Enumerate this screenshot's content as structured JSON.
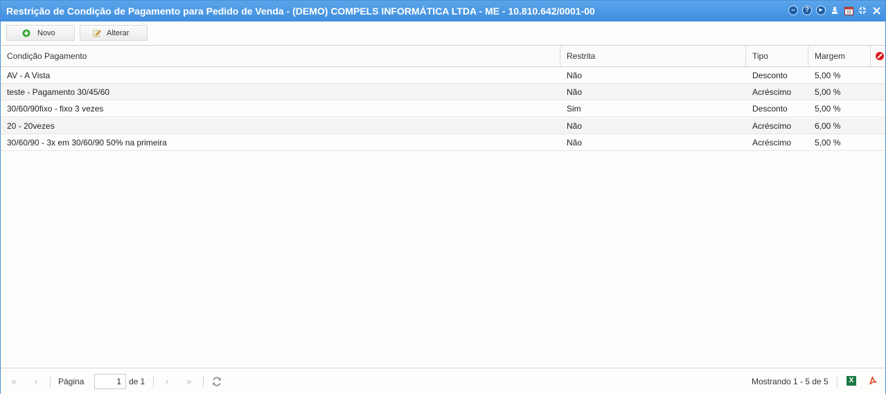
{
  "window": {
    "title": "Restrição de Condição de Pagamento para Pedido de Venda - (DEMO) COMPELS INFORMÁTICA LTDA - ME - 10.810.642/0001-00",
    "icons": [
      "minimize-icon",
      "help-icon",
      "next-icon",
      "download-icon",
      "calendar-icon",
      "collapse-icon",
      "close-icon"
    ]
  },
  "toolbar": {
    "novo_label": "Novo",
    "alterar_label": "Alterar"
  },
  "grid": {
    "columns": [
      "Condição Pagamento",
      "Restrita",
      "Tipo",
      "Margem"
    ],
    "rows": [
      {
        "condicao": "AV - A Vista",
        "restrita": "Não",
        "tipo": "Desconto",
        "margem": "5,00 %"
      },
      {
        "condicao": "teste - Pagamento 30/45/60",
        "restrita": "Não",
        "tipo": "Acréscimo",
        "margem": "5,00 %"
      },
      {
        "condicao": "30/60/90fixo - fixo 3 vezes",
        "restrita": "Sim",
        "tipo": "Desconto",
        "margem": "5,00 %"
      },
      {
        "condicao": "20 - 20vezes",
        "restrita": "Não",
        "tipo": "Acréscimo",
        "margem": "6,00 %"
      },
      {
        "condicao": "30/60/90 - 3x em 30/60/90 50% na primeira",
        "restrita": "Não",
        "tipo": "Acréscimo",
        "margem": "5,00 %"
      }
    ]
  },
  "pager": {
    "page_label": "Página",
    "page_value": "1",
    "of_label": "de 1",
    "showing": "Mostrando 1 - 5 de 5"
  },
  "colors": {
    "titlebar": "#4a98e6",
    "excel": "#1d7a45",
    "pdf": "#e2462a",
    "add": "#3aa935",
    "clear": "#d81e1e"
  }
}
